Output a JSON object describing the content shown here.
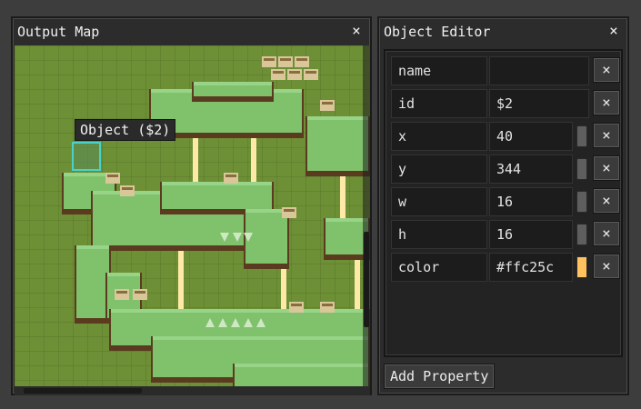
{
  "left_panel": {
    "title": "Output Map",
    "close_label": "×",
    "tooltip": "Object ($2)"
  },
  "right_panel": {
    "title": "Object Editor",
    "close_label": "×",
    "properties": [
      {
        "key": "name",
        "value": "",
        "control": "none"
      },
      {
        "key": "id",
        "value": "$2",
        "control": "none"
      },
      {
        "key": "x",
        "value": "40",
        "control": "slider"
      },
      {
        "key": "y",
        "value": "344",
        "control": "slider"
      },
      {
        "key": "w",
        "value": "16",
        "control": "slider"
      },
      {
        "key": "h",
        "value": "16",
        "control": "slider"
      },
      {
        "key": "color",
        "value": "#ffc25c",
        "control": "swatch"
      }
    ],
    "delete_label": "×",
    "add_button_label": "Add Property"
  },
  "colors": {
    "map_background": "#6d8f35",
    "grass": "#7fc26b",
    "grass_light": "#98d487",
    "dirt": "#5a3b1f",
    "pillar": "#ffe9a8",
    "selection_outline": "#49d3c6",
    "swatch": "#ffc25c"
  }
}
